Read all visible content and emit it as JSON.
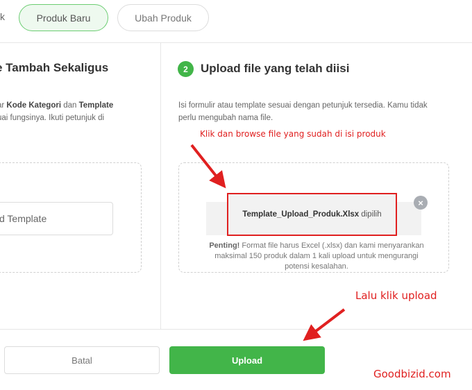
{
  "tabs": {
    "partial_label": "k",
    "active_label": "Produk Baru",
    "inactive_label": "Ubah Produk"
  },
  "left_panel": {
    "title": "e Tambah Sekaligus",
    "desc_line1_prefix": "ar ",
    "desc_line1_bold1": "Kode Kategori",
    "desc_line1_mid": " dan ",
    "desc_line1_bold2": "Template",
    "desc_line2": "uai fungsinya. Ikuti petunjuk di",
    "download_label": "d Template"
  },
  "right_panel": {
    "step_number": "2",
    "title": "Upload file yang telah diisi",
    "desc": "Isi formulir atau template sesuai dengan petunjuk tersedia. Kamu tidak perlu mengubah nama file.",
    "file_name": "Template_Upload_Produk.Xlsx",
    "file_status": "dipilih",
    "notice_bold": "Penting!",
    "notice_text": " Format file harus Excel (.xlsx) dan kami menyarankan maksimal 150 produk dalam 1 kali upload untuk mengurangi potensi kesalahan."
  },
  "footer": {
    "cancel_label": "Batal",
    "upload_label": "Upload"
  },
  "annotations": {
    "browse_hint": "Klik dan browse file yang sudah di isi produk",
    "upload_hint": "Lalu klik upload",
    "watermark": "Goodbizid.com"
  },
  "icons": {
    "remove": "close-circle-icon",
    "arrows": "red-arrow-icon"
  },
  "colors": {
    "accent_green": "#42b549",
    "annotation_red": "#e02020"
  }
}
